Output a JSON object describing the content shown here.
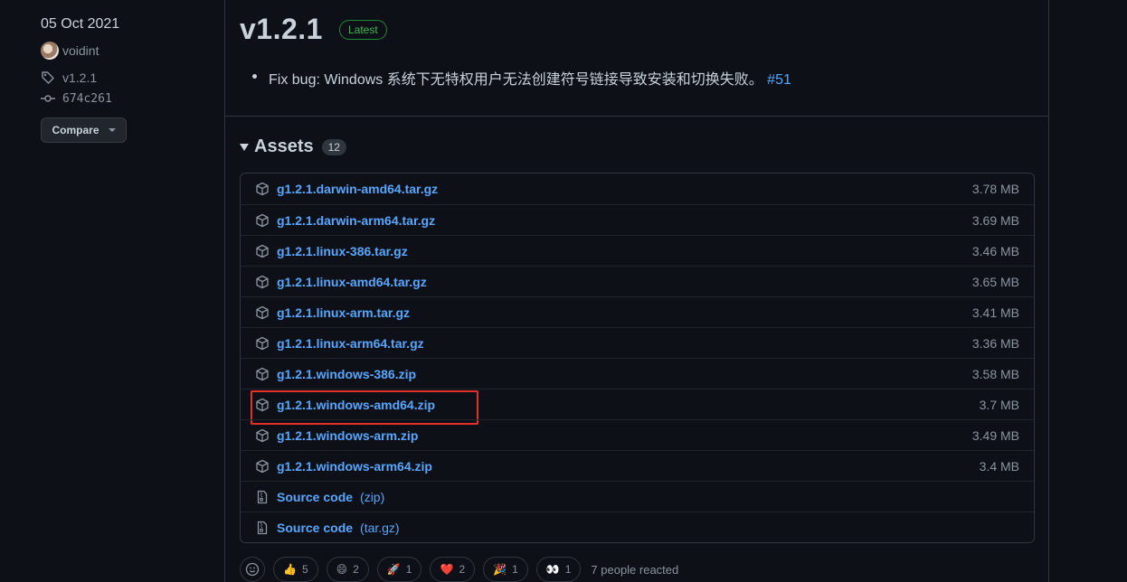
{
  "meta": {
    "date": "05 Oct 2021",
    "author": "voidint",
    "tag": "v1.2.1",
    "commit": "674c261",
    "compare_label": "Compare"
  },
  "release": {
    "title": "v1.2.1",
    "badge": "Latest",
    "note_text": "Fix bug: Windows 系统下无特权用户无法创建符号链接导致安装和切换失败。",
    "note_link": "#51"
  },
  "assets": {
    "title": "Assets",
    "count": "12",
    "items": [
      {
        "name": "g1.2.1.darwin-amd64.tar.gz",
        "size": "3.78 MB",
        "icon": "package-icon"
      },
      {
        "name": "g1.2.1.darwin-arm64.tar.gz",
        "size": "3.69 MB",
        "icon": "package-icon"
      },
      {
        "name": "g1.2.1.linux-386.tar.gz",
        "size": "3.46 MB",
        "icon": "package-icon"
      },
      {
        "name": "g1.2.1.linux-amd64.tar.gz",
        "size": "3.65 MB",
        "icon": "package-icon"
      },
      {
        "name": "g1.2.1.linux-arm.tar.gz",
        "size": "3.41 MB",
        "icon": "package-icon"
      },
      {
        "name": "g1.2.1.linux-arm64.tar.gz",
        "size": "3.36 MB",
        "icon": "package-icon"
      },
      {
        "name": "g1.2.1.windows-386.zip",
        "size": "3.58 MB",
        "icon": "package-icon"
      },
      {
        "name": "g1.2.1.windows-amd64.zip",
        "size": "3.7 MB",
        "icon": "package-icon",
        "highlighted": true
      },
      {
        "name": "g1.2.1.windows-arm.zip",
        "size": "3.49 MB",
        "icon": "package-icon"
      },
      {
        "name": "g1.2.1.windows-arm64.zip",
        "size": "3.4 MB",
        "icon": "package-icon"
      }
    ],
    "source": [
      {
        "name": "Source code",
        "suffix": "(zip)",
        "icon": "file-zip-icon"
      },
      {
        "name": "Source code",
        "suffix": "(tar.gz)",
        "icon": "file-zip-icon"
      }
    ]
  },
  "colors": {
    "background": "#0d1117",
    "link": "#58a6ff",
    "latest_badge": "#3fb950",
    "highlight": "#e5302a"
  },
  "reactions": [
    {
      "emoji": "👍",
      "count": "5"
    },
    {
      "emoji": "😄",
      "count": "2"
    },
    {
      "emoji": "🚀",
      "count": "1"
    },
    {
      "emoji": "❤️",
      "count": "2"
    },
    {
      "emoji": "🎉",
      "count": "1"
    },
    {
      "emoji": "👀",
      "count": "1"
    }
  ],
  "reactions_text": "7 people reacted"
}
